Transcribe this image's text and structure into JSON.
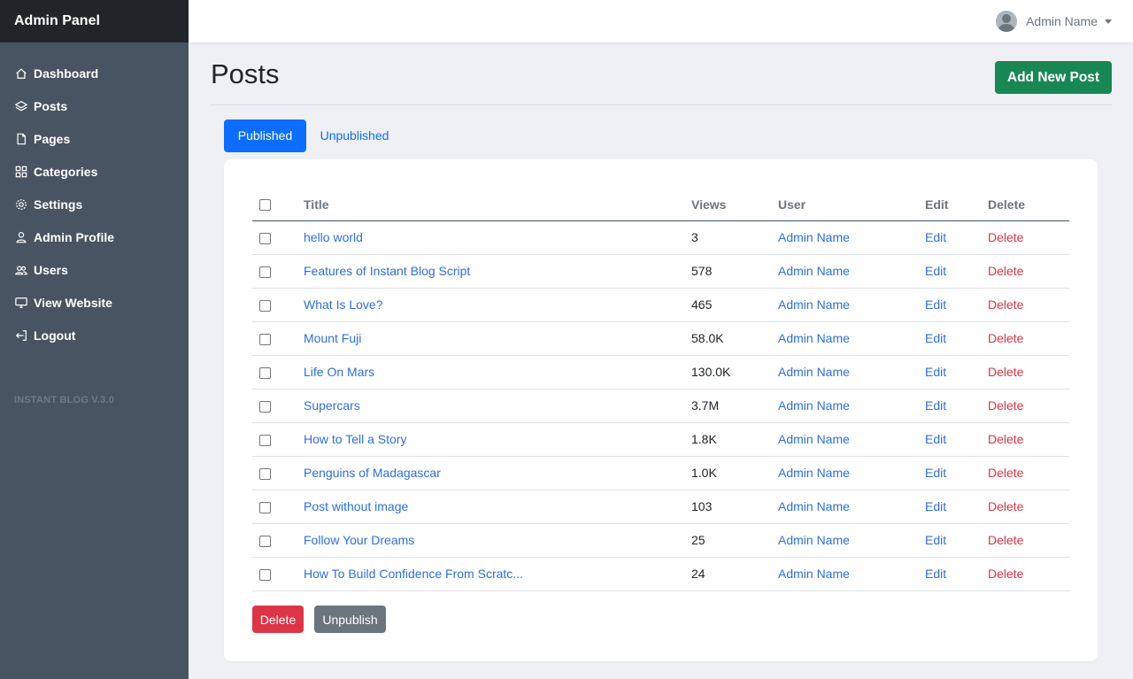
{
  "sidebar": {
    "brand": "Admin Panel",
    "items": [
      {
        "label": "Dashboard",
        "icon": "home-icon"
      },
      {
        "label": "Posts",
        "icon": "layers-icon"
      },
      {
        "label": "Pages",
        "icon": "file-icon"
      },
      {
        "label": "Categories",
        "icon": "grid-icon"
      },
      {
        "label": "Settings",
        "icon": "gear-icon"
      },
      {
        "label": "Admin Profile",
        "icon": "person-icon"
      },
      {
        "label": "Users",
        "icon": "people-icon"
      },
      {
        "label": "View Website",
        "icon": "display-icon"
      },
      {
        "label": "Logout",
        "icon": "logout-icon"
      }
    ],
    "version": "INSTANT BLOG V.3.0"
  },
  "header": {
    "user_name": "Admin Name"
  },
  "main": {
    "title": "Posts",
    "add_button": "Add New Post",
    "tabs": [
      {
        "label": "Published",
        "active": true
      },
      {
        "label": "Unpublished",
        "active": false
      }
    ],
    "table": {
      "headers": [
        "Title",
        "Views",
        "User",
        "Edit",
        "Delete"
      ],
      "rows": [
        {
          "title": "hello world",
          "views": "3",
          "user": "Admin Name",
          "edit": "Edit",
          "delete": "Delete"
        },
        {
          "title": "Features of Instant Blog Script",
          "views": "578",
          "user": "Admin Name",
          "edit": "Edit",
          "delete": "Delete"
        },
        {
          "title": "What Is Love?",
          "views": "465",
          "user": "Admin Name",
          "edit": "Edit",
          "delete": "Delete"
        },
        {
          "title": "Mount Fuji",
          "views": "58.0K",
          "user": "Admin Name",
          "edit": "Edit",
          "delete": "Delete"
        },
        {
          "title": "Life On Mars",
          "views": "130.0K",
          "user": "Admin Name",
          "edit": "Edit",
          "delete": "Delete"
        },
        {
          "title": "Supercars",
          "views": "3.7M",
          "user": "Admin Name",
          "edit": "Edit",
          "delete": "Delete"
        },
        {
          "title": "How to Tell a Story",
          "views": "1.8K",
          "user": "Admin Name",
          "edit": "Edit",
          "delete": "Delete"
        },
        {
          "title": "Penguins of Madagascar",
          "views": "1.0K",
          "user": "Admin Name",
          "edit": "Edit",
          "delete": "Delete"
        },
        {
          "title": "Post without image",
          "views": "103",
          "user": "Admin Name",
          "edit": "Edit",
          "delete": "Delete"
        },
        {
          "title": "Follow Your Dreams",
          "views": "25",
          "user": "Admin Name",
          "edit": "Edit",
          "delete": "Delete"
        },
        {
          "title": "How To Build Confidence From Scratc...",
          "views": "24",
          "user": "Admin Name",
          "edit": "Edit",
          "delete": "Delete"
        }
      ]
    },
    "bulk_delete": "Delete",
    "bulk_unpublish": "Unpublish"
  },
  "colors": {
    "sidebar_bg": "#485462",
    "brand_bg": "#212529",
    "primary": "#0d6efd",
    "success": "#198754",
    "danger": "#dc3545",
    "secondary": "#6c757d"
  }
}
